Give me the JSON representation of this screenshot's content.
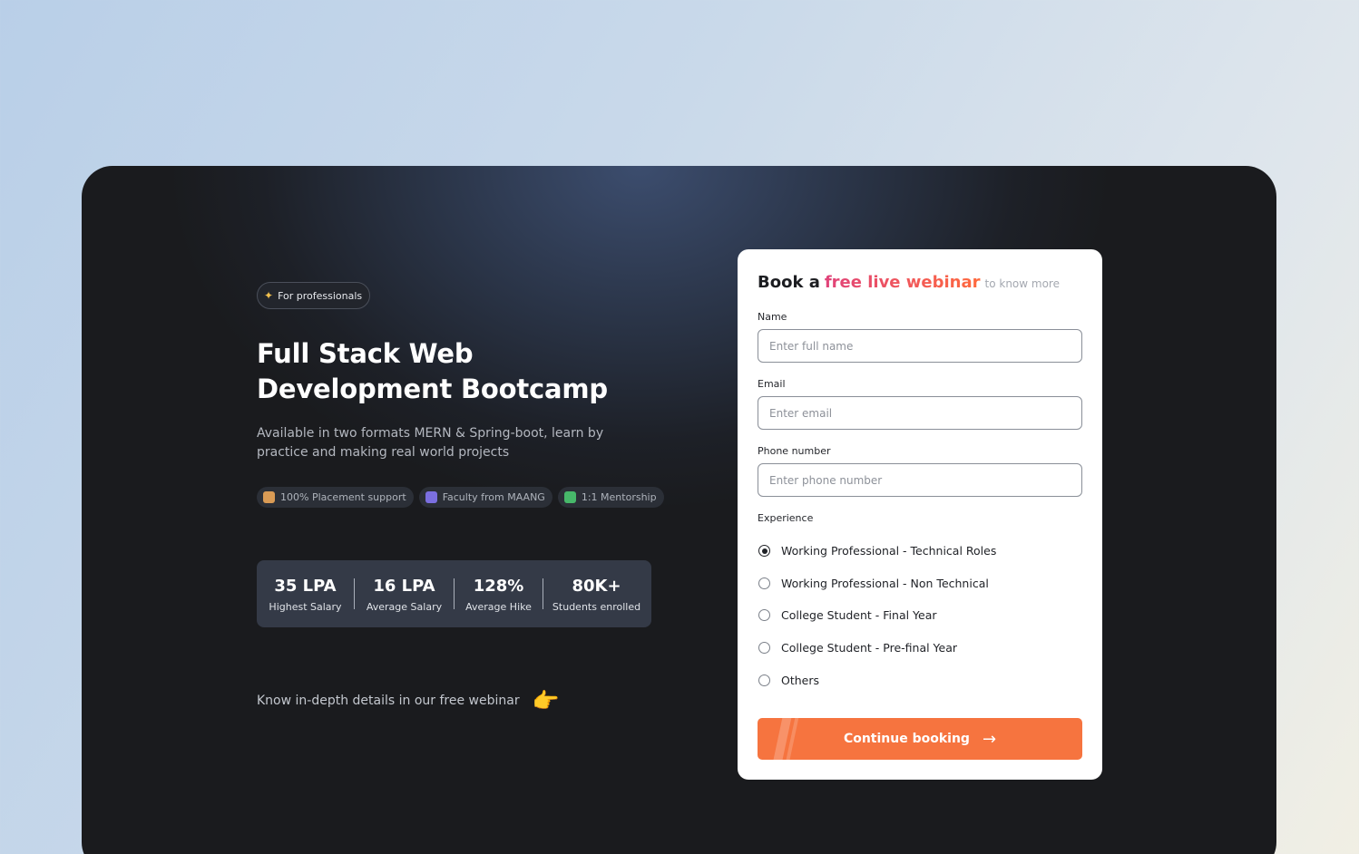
{
  "hero": {
    "badge": "For professionals",
    "title_line1": "Full Stack Web",
    "title_line2": "Development Bootcamp",
    "description": "Available in two formats MERN & Spring-boot, learn by practice and making real world projects",
    "chips": [
      {
        "label": "100% Placement support",
        "icon": "briefcase-icon"
      },
      {
        "label": "Faculty from MAANG",
        "icon": "graduation-cap-icon"
      },
      {
        "label": "1:1 Mentorship",
        "icon": "chat-icon"
      }
    ],
    "stats": [
      {
        "value": "35 LPA",
        "label": "Highest Salary"
      },
      {
        "value": "16 LPA",
        "label": "Average Salary"
      },
      {
        "value": "128%",
        "label": "Average Hike"
      },
      {
        "value": "80K+",
        "label": "Students enrolled"
      }
    ],
    "know_more": "Know in-depth details in our free webinar"
  },
  "form": {
    "heading_prefix": "Book a",
    "heading_highlight": "free live webinar",
    "heading_suffix": "to know more",
    "name_label": "Name",
    "name_placeholder": "Enter full name",
    "email_label": "Email",
    "email_placeholder": "Enter email",
    "phone_label": "Phone number",
    "phone_placeholder": "Enter phone number",
    "experience_label": "Experience",
    "experience_options": [
      "Working Professional - Technical Roles",
      "Working Professional - Non Technical",
      "College Student - Final Year",
      "College Student - Pre-final Year",
      "Others"
    ],
    "selected_option": 0,
    "submit_label": "Continue booking"
  },
  "colors": {
    "accent_orange": "#f6743f",
    "highlight_pink": "#e0437a"
  }
}
